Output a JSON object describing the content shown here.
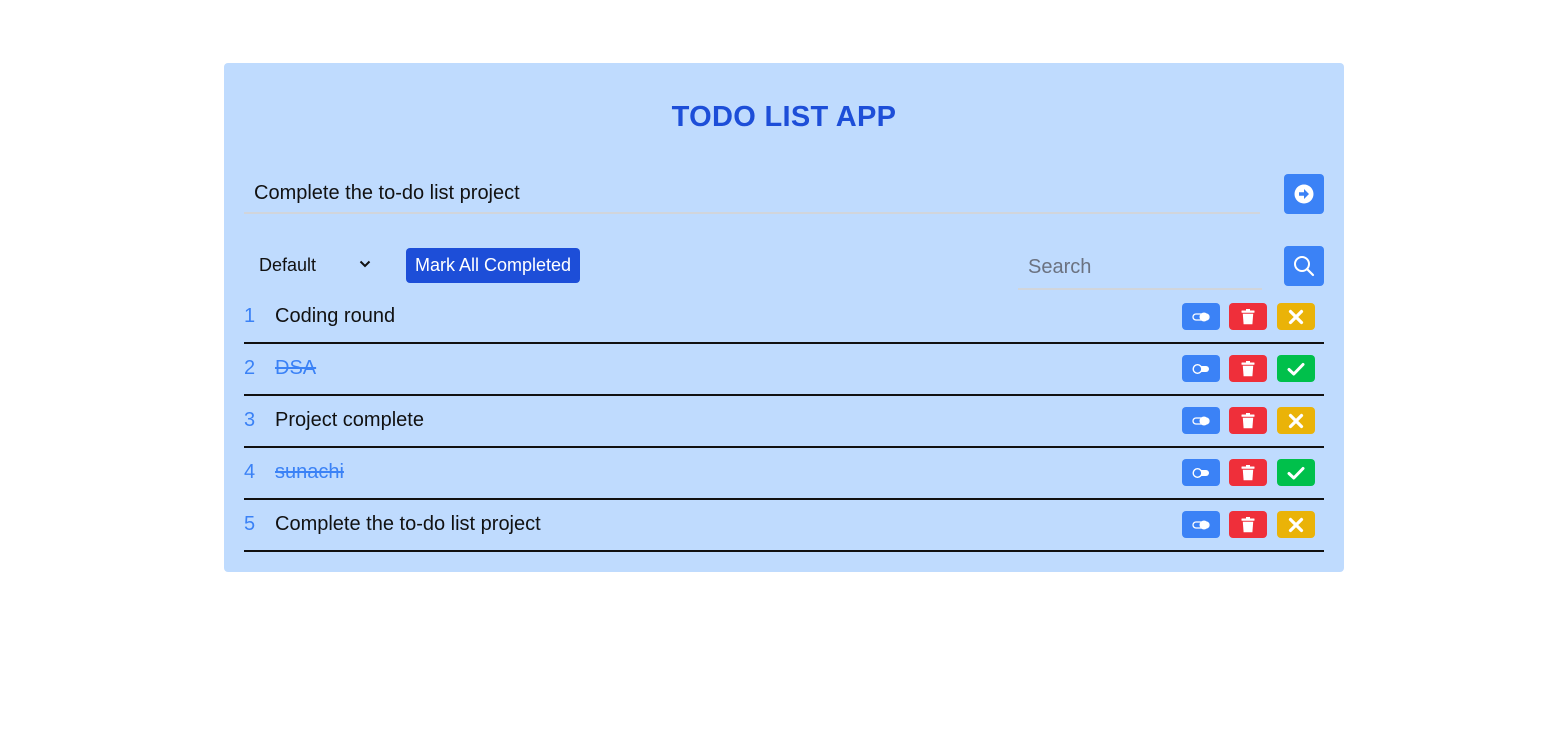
{
  "app": {
    "title": "TODO LIST APP"
  },
  "new_task": {
    "value": "Complete the to-do list project",
    "add_icon": "arrow-circle-right-icon"
  },
  "toolbar": {
    "filter_selected": "Default",
    "mark_all_label": "Mark All Completed",
    "search_placeholder": "Search",
    "search_value": "",
    "search_icon": "search-icon"
  },
  "todos": [
    {
      "num": "1",
      "text": "Coding round",
      "completed": false
    },
    {
      "num": "2",
      "text": "DSA",
      "completed": true
    },
    {
      "num": "3",
      "text": "Project complete",
      "completed": false
    },
    {
      "num": "4",
      "text": "sunachi",
      "completed": true
    },
    {
      "num": "5",
      "text": "Complete the to-do list project",
      "completed": false
    }
  ],
  "colors": {
    "card_bg": "#bfdbfe",
    "title": "#1d4ed8",
    "primary": "#3b82f6",
    "mark_all": "#1d4ed8",
    "delete": "#ef2f3a",
    "incomplete_toggle": "#eab308",
    "complete_toggle": "#00c04b"
  }
}
